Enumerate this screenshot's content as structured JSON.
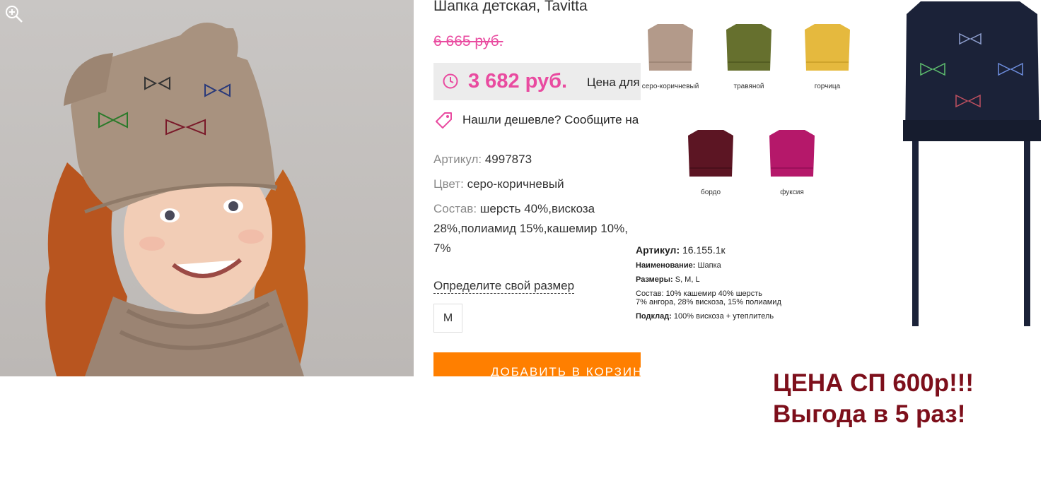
{
  "product": {
    "title": "Шапка детская, Tavitta",
    "old_price": "6 665 руб.",
    "price": "3 682 руб.",
    "price_note": "Цена для",
    "cheaper_text": "Нашли дешевле? Сообщите на",
    "attributes": [
      {
        "label": "Артикул:",
        "value": "4997873"
      },
      {
        "label": "Цвет:",
        "value": "серо-коричневый"
      },
      {
        "label": "Состав:",
        "value": "шерсть 40%,вискоза"
      }
    ],
    "composition_cont": [
      "28%,полиамид 15%,кашемир 10%,",
      "7%"
    ],
    "size_link": "Определите свой размер",
    "size_option": "M",
    "add_to_cart": "ДОБАВИТЬ В КОРЗИНУ"
  },
  "swatches": [
    {
      "label": "серо-коричневый",
      "color": "#b39a8a"
    },
    {
      "label": "травяной",
      "color": "#66702e"
    },
    {
      "label": "горчица",
      "color": "#e5b93e"
    },
    {
      "label": "бордо",
      "color": "#5c1523"
    },
    {
      "label": "фуксия",
      "color": "#b5186a"
    }
  ],
  "spec": {
    "article_label": "Артикул:",
    "article_value": "16.155.1к",
    "name_label": "Наименование:",
    "name_value": "Шапка",
    "sizes_label": "Размеры:",
    "sizes_value": "S, M, L",
    "composition_label": "Состав:",
    "composition_value": "10% кашемир 40% шерсть",
    "composition_value2": "7% ангора, 28% вискоза, 15% полиамид",
    "lining_label": "Подклад:",
    "lining_value": "100% вискоза + утеплитель"
  },
  "promo": {
    "line1": "ЦЕНА СП 600р!!!",
    "line2": "Выгода в 5 раз!"
  },
  "colors": {
    "price_pink": "#e94ba0",
    "cart_orange": "#ff7f00",
    "promo_red": "#7d0f1b",
    "hat_beige": "#a8927f",
    "hat_navy": "#1b2238"
  }
}
